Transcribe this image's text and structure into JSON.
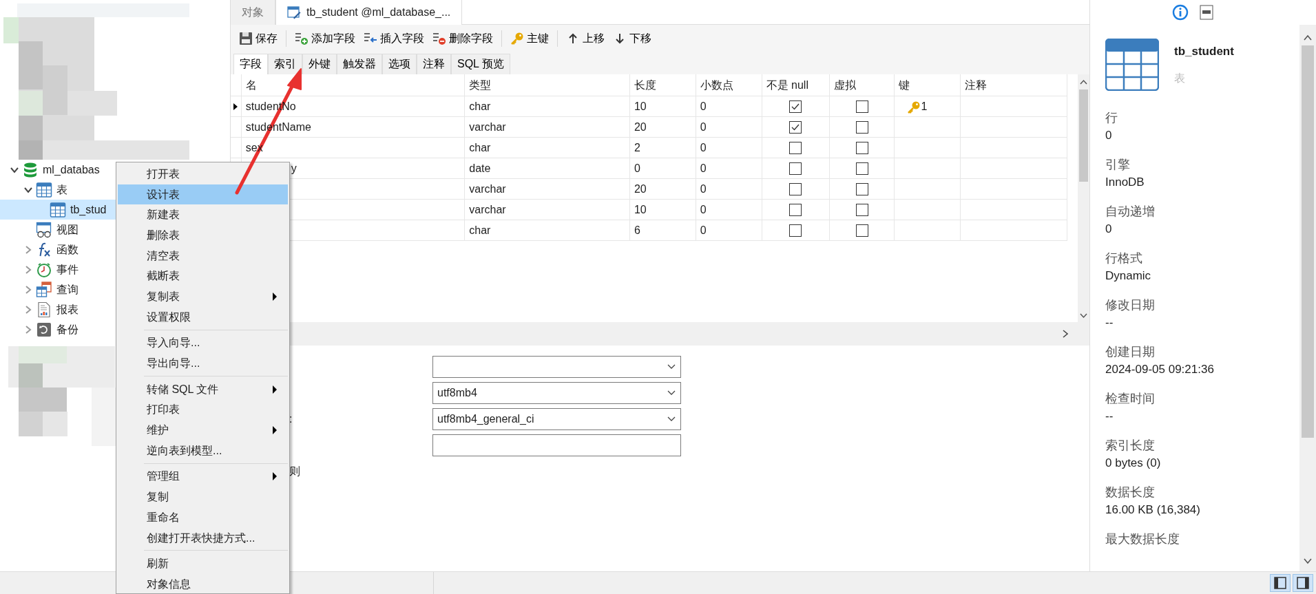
{
  "sidebar": {
    "tree": [
      {
        "label": "ml_databas",
        "kind": "database",
        "expanded": true,
        "selected": false,
        "children": [
          {
            "label": "表",
            "kind": "tables",
            "expanded": true,
            "selected": false,
            "children": [
              {
                "label": "tb_stud",
                "kind": "table",
                "selected": true
              }
            ]
          },
          {
            "label": "视图",
            "kind": "views",
            "selected": false
          },
          {
            "label": "函数",
            "kind": "functions",
            "expanded": false,
            "selected": false
          },
          {
            "label": "事件",
            "kind": "events",
            "expanded": false,
            "selected": false
          },
          {
            "label": "查询",
            "kind": "queries",
            "expanded": false,
            "selected": false
          },
          {
            "label": "报表",
            "kind": "reports",
            "expanded": false,
            "selected": false
          },
          {
            "label": "备份",
            "kind": "backups",
            "expanded": false,
            "selected": false
          }
        ]
      }
    ]
  },
  "tabs": [
    {
      "label": "对象",
      "selected": false
    },
    {
      "label": "tb_student @ml_database_...",
      "selected": true
    }
  ],
  "toolbar": [
    {
      "label": "保存",
      "kind": "save",
      "separator_after": true
    },
    {
      "label": "添加字段",
      "kind": "add",
      "separator_after": false
    },
    {
      "label": "插入字段",
      "kind": "insert",
      "separator_after": false
    },
    {
      "label": "删除字段",
      "kind": "delete",
      "separator_after": true
    },
    {
      "label": "主键",
      "kind": "key",
      "separator_after": true
    },
    {
      "label": "上移",
      "kind": "up",
      "separator_after": false
    },
    {
      "label": "下移",
      "kind": "down",
      "separator_after": false
    }
  ],
  "subtabs": [
    {
      "label": "字段",
      "selected": true
    },
    {
      "label": "索引",
      "selected": false
    },
    {
      "label": "外键",
      "selected": false
    },
    {
      "label": "触发器",
      "selected": false
    },
    {
      "label": "选项",
      "selected": false
    },
    {
      "label": "注释",
      "selected": false
    },
    {
      "label": "SQL 预览",
      "selected": false
    }
  ],
  "table": {
    "columns": [
      "名",
      "类型",
      "长度",
      "小数点",
      "不是 null",
      "虚拟",
      "键",
      "注释"
    ],
    "rows": [
      {
        "current": true,
        "name": "studentNo",
        "type": "char",
        "length": "10",
        "decimals": "0",
        "not_null": true,
        "virtual": false,
        "key": "1"
      },
      {
        "current": false,
        "name": "studentName",
        "type": "varchar",
        "length": "20",
        "decimals": "0",
        "not_null": true,
        "virtual": false
      },
      {
        "current": false,
        "name": "sex",
        "type": "char",
        "length": "2",
        "decimals": "0",
        "not_null": false,
        "virtual": false
      },
      {
        "current": false,
        "name_tail": "y",
        "type": "date",
        "length": "0",
        "decimals": "0",
        "not_null": false,
        "virtual": false
      },
      {
        "current": false,
        "type": "varchar",
        "length": "20",
        "decimals": "0",
        "not_null": false,
        "virtual": false
      },
      {
        "current": false,
        "type": "varchar",
        "length": "10",
        "decimals": "0",
        "not_null": false,
        "virtual": false
      },
      {
        "current": false,
        "type": "char",
        "length": "6",
        "decimals": "0",
        "not_null": false,
        "virtual": false
      }
    ]
  },
  "form": [
    {
      "kind": "select"
    },
    {
      "kind": "select",
      "value": "utf8mb4"
    },
    {
      "kind": "select",
      "label_tail": ":",
      "value": "utf8mb4_general_ci"
    },
    {
      "kind": "text"
    },
    {
      "kind": "label",
      "label_tail": "则"
    }
  ],
  "context_menu": [
    {
      "label": "打开表",
      "selected": false,
      "submenu": false,
      "separator_after": false
    },
    {
      "label": "设计表",
      "selected": true,
      "submenu": false,
      "separator_after": false
    },
    {
      "label": "新建表",
      "selected": false,
      "submenu": false,
      "separator_after": false
    },
    {
      "label": "删除表",
      "selected": false,
      "submenu": false,
      "separator_after": false
    },
    {
      "label": "清空表",
      "selected": false,
      "submenu": false,
      "separator_after": false
    },
    {
      "label": "截断表",
      "selected": false,
      "submenu": false,
      "separator_after": false
    },
    {
      "label": "复制表",
      "selected": false,
      "submenu": true,
      "separator_after": false
    },
    {
      "label": "设置权限",
      "selected": false,
      "submenu": false,
      "separator_after": true
    },
    {
      "label": "导入向导...",
      "selected": false,
      "submenu": false,
      "separator_after": false
    },
    {
      "label": "导出向导...",
      "selected": false,
      "submenu": false,
      "separator_after": true
    },
    {
      "label": "转储 SQL 文件",
      "selected": false,
      "submenu": true,
      "separator_after": false
    },
    {
      "label": "打印表",
      "selected": false,
      "submenu": false,
      "separator_after": false
    },
    {
      "label": "维护",
      "selected": false,
      "submenu": true,
      "separator_after": false
    },
    {
      "label": "逆向表到模型...",
      "selected": false,
      "submenu": false,
      "separator_after": true
    },
    {
      "label": "管理组",
      "selected": false,
      "submenu": true,
      "separator_after": false
    },
    {
      "label": "复制",
      "selected": false,
      "submenu": false,
      "separator_after": false
    },
    {
      "label": "重命名",
      "selected": false,
      "submenu": false,
      "separator_after": false
    },
    {
      "label": "创建打开表快捷方式...",
      "selected": false,
      "submenu": false,
      "separator_after": true
    },
    {
      "label": "刷新",
      "selected": false,
      "submenu": false,
      "separator_after": false
    },
    {
      "label": "对象信息",
      "selected": false,
      "submenu": false,
      "separator_after": false
    }
  ],
  "info_panel": {
    "title": "tb_student",
    "subtitle": "表",
    "properties": [
      {
        "label": "行",
        "value": "0"
      },
      {
        "label": "引擎",
        "value": "InnoDB"
      },
      {
        "label": "自动递增",
        "value": "0"
      },
      {
        "label": "行格式",
        "value": "Dynamic"
      },
      {
        "label": "修改日期",
        "value": "--"
      },
      {
        "label": "创建日期",
        "value": "2024-09-05 09:21:36"
      },
      {
        "label": "检查时间",
        "value": "--"
      },
      {
        "label": "索引长度",
        "value": "0 bytes (0)"
      },
      {
        "label": "数据长度",
        "value": "16.00 KB (16,384)"
      },
      {
        "label": "最大数据长度"
      }
    ]
  }
}
